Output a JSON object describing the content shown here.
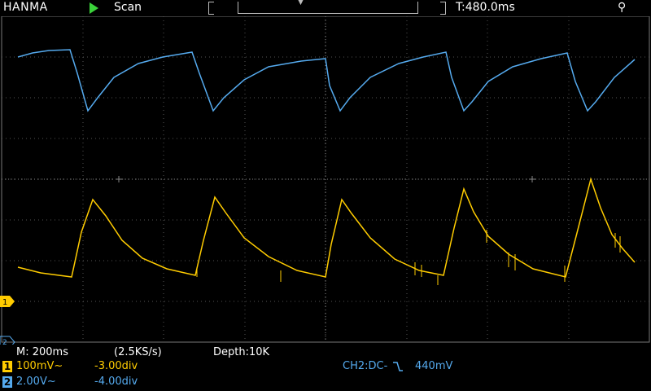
{
  "header": {
    "brand": "HANMA",
    "mode": "Scan",
    "trigger_position": "T:480.0ms"
  },
  "status": {
    "memory_timebase": "M: 200ms",
    "sample_rate": "(2.5KS/s)",
    "depth": "Depth:10K"
  },
  "channels": [
    {
      "badge": "1",
      "scale": "100mV~",
      "offset": "-3.00div",
      "color": "#ffcc00"
    },
    {
      "badge": "2",
      "scale": "2.00V~",
      "offset": "-4.00div",
      "color": "#55aaee"
    }
  ],
  "trigger": {
    "source": "CH2:DC-",
    "level": "440mV"
  },
  "markers": {
    "ch1": "1",
    "ch2": "2"
  },
  "colors": {
    "ch1": "#ffcc00",
    "ch2": "#55aaee",
    "trigger_text": "#55aaee"
  }
}
